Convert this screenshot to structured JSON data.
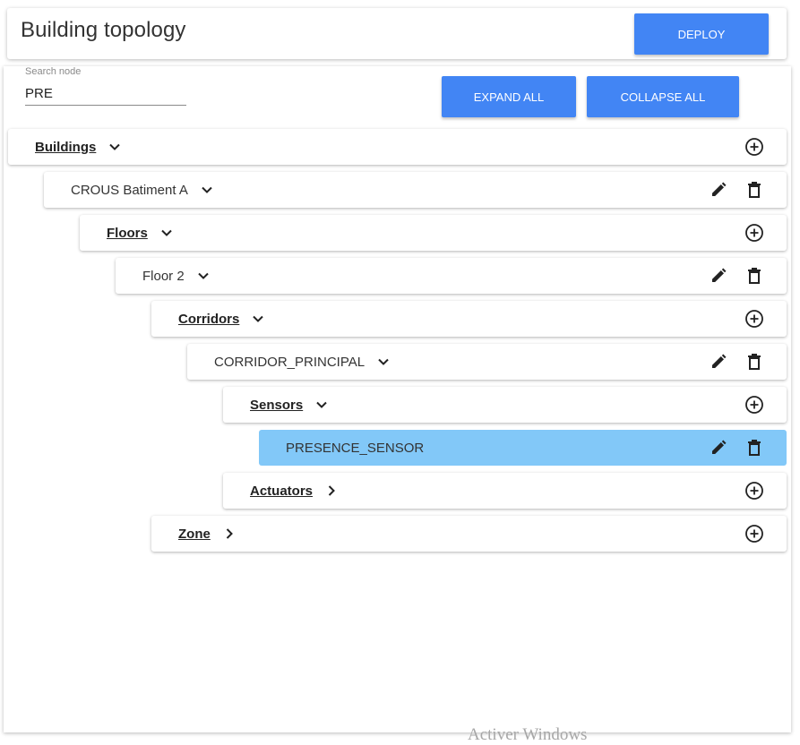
{
  "header": {
    "title": "Building topology",
    "deploy_label": "DEPLOY"
  },
  "search": {
    "label": "Search node",
    "value": "PRE"
  },
  "toolbar": {
    "expand_label": "EXPAND ALL",
    "collapse_label": "COLLAPSE ALL"
  },
  "tree": {
    "buildings": {
      "label": "Buildings",
      "expanded": true
    },
    "building_a": {
      "label": "CROUS Batiment A",
      "expanded": true
    },
    "floors": {
      "label": "Floors",
      "expanded": true
    },
    "floor_2": {
      "label": "Floor 2",
      "expanded": true
    },
    "corridors": {
      "label": "Corridors",
      "expanded": true
    },
    "corridor_principal": {
      "label": "CORRIDOR_PRINCIPAL",
      "expanded": true
    },
    "sensors": {
      "label": "Sensors",
      "expanded": true
    },
    "presence_sensor": {
      "label": "PRESENCE_SENSOR",
      "selected": true
    },
    "actuators": {
      "label": "Actuators",
      "expanded": false
    },
    "zone": {
      "label": "Zone",
      "expanded": false
    }
  },
  "icons": {
    "add": "add-circle-icon",
    "edit": "pencil-icon",
    "delete": "trash-icon",
    "expanded": "chevron-down-icon",
    "collapsed": "chevron-right-icon"
  },
  "watermark": "Activer Windows",
  "colors": {
    "primary": "#4285f4",
    "selected_row": "#82c8f8"
  }
}
